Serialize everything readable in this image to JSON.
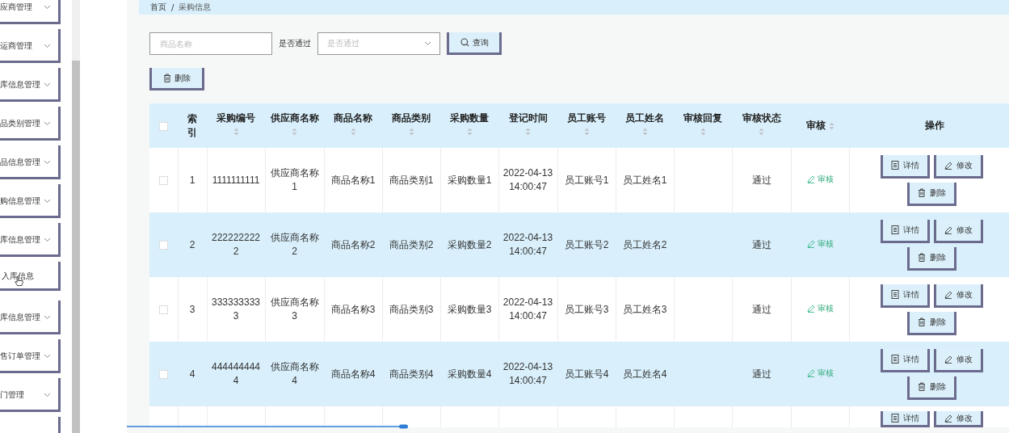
{
  "sidebar": {
    "items": [
      {
        "label": "应商管理",
        "kind": "group"
      },
      {
        "label": "运商管理",
        "kind": "group"
      },
      {
        "label": "库信息管理",
        "kind": "group"
      },
      {
        "label": "品类别管理",
        "kind": "group"
      },
      {
        "label": "品信息管理",
        "kind": "group"
      },
      {
        "label": "购信息管理",
        "kind": "group"
      },
      {
        "label": "库信息管理",
        "kind": "group"
      },
      {
        "label": "入库信息",
        "kind": "sub"
      },
      {
        "label": "库信息管理",
        "kind": "group"
      },
      {
        "label": "售订单管理",
        "kind": "group"
      },
      {
        "label": "门管理",
        "kind": "group"
      },
      {
        "kind": "stub"
      }
    ]
  },
  "breadcrumb": [
    "首页",
    "/",
    "采购信息"
  ],
  "filters": {
    "name_placeholder": "商品名称",
    "pass_label": "是否通过",
    "pass_placeholder": "是否通过",
    "search_button": "查询"
  },
  "delete_button": "删除",
  "table": {
    "all_checked": false,
    "columns": [
      {
        "label": "索引",
        "kind": "plain"
      },
      {
        "label": "采购编号",
        "kind": "sort"
      },
      {
        "label": "供应商名称",
        "kind": "sort"
      },
      {
        "label": "商品名称",
        "kind": "sort"
      },
      {
        "label": "商品类别",
        "kind": "sort"
      },
      {
        "label": "采购数量",
        "kind": "sort"
      },
      {
        "label": "登记时间",
        "kind": "sort"
      },
      {
        "label": "员工账号",
        "kind": "sort"
      },
      {
        "label": "员工姓名",
        "kind": "sort"
      },
      {
        "label": "审核回复",
        "kind": "sort"
      },
      {
        "label": "审核状态",
        "kind": "sort"
      },
      {
        "label": "审核",
        "kind": "sort-inline"
      },
      {
        "label": "操作",
        "kind": "plain"
      }
    ],
    "rows": [
      {
        "checked": false,
        "cells": [
          "1",
          "1111111111",
          "供应商名称1",
          "商品名称1",
          "商品类别1",
          "采购数量1",
          "2022-04-13 14:00:47",
          "员工账号1",
          "员工姓名1",
          null,
          "通过",
          "审核"
        ],
        "actions": [
          "详情",
          "修改",
          "删除"
        ]
      },
      {
        "checked": false,
        "cells": [
          "2",
          "2222222222",
          "供应商名称2",
          "商品名称2",
          "商品类别2",
          "采购数量2",
          "2022-04-13 14:00:47",
          "员工账号2",
          "员工姓名2",
          null,
          "通过",
          "审核"
        ],
        "actions": [
          "详情",
          "修改",
          "删除"
        ]
      },
      {
        "checked": false,
        "cells": [
          "3",
          "3333333333",
          "供应商名称3",
          "商品名称3",
          "商品类别3",
          "采购数量3",
          "2022-04-13 14:00:47",
          "员工账号3",
          "员工姓名3",
          null,
          "通过",
          "审核"
        ],
        "actions": [
          "详情",
          "修改",
          "删除"
        ]
      },
      {
        "checked": false,
        "cells": [
          "4",
          "4444444444",
          "供应商名称4",
          "商品名称4",
          "商品类别4",
          "采购数量4",
          "2022-04-13 14:00:47",
          "员工账号4",
          "员工姓名4",
          null,
          "通过",
          "审核"
        ],
        "actions": [
          "详情",
          "修改",
          "删除"
        ]
      }
    ],
    "partial_row_actions": [
      "详情",
      "修改"
    ]
  }
}
